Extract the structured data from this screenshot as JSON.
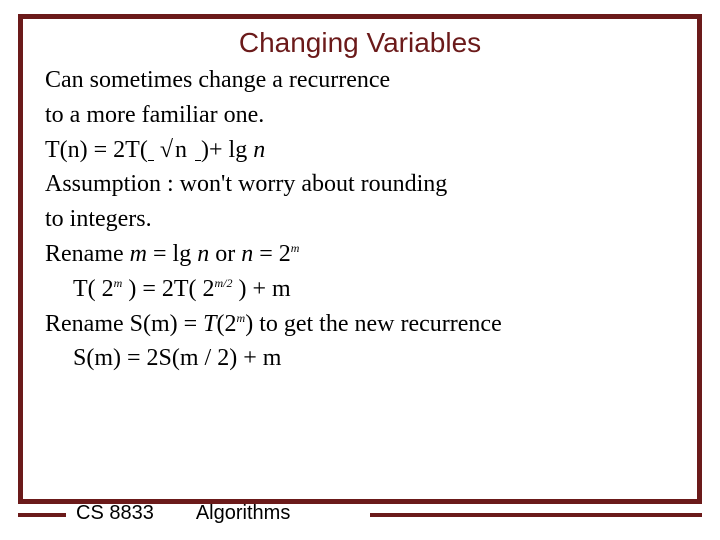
{
  "title": "Changing Variables",
  "lines": {
    "l1": "Can sometimes change a recurrence",
    "l2": "to a more familiar one.",
    "l3_pre": "T(n) = 2T",
    "l3_mid": "n",
    "l3_post": "+ lg ",
    "l3_n": "n",
    "l4": "Assumption :  won't worry about rounding",
    "l5": "to integers.",
    "l6_a": "Rename ",
    "l6_b": "m",
    "l6_c": " = lg ",
    "l6_d": "n",
    "l6_e": " or ",
    "l6_f": "n",
    "l6_g": " = 2",
    "l6_h": "m",
    "l7_a": "T( 2",
    "l7_b": "m",
    "l7_c": " ) = 2T( 2",
    "l7_d": "m/2",
    "l7_e": " ) + m",
    "l8_a": "Rename S(m) = ",
    "l8_b": "T",
    "l8_c": "(2",
    "l8_d": "m",
    "l8_e": ") to get the new recurrence",
    "l9": "S(m) = 2S(m / 2) + m"
  },
  "footer": {
    "course": "CS 8833",
    "subject": "Algorithms"
  }
}
